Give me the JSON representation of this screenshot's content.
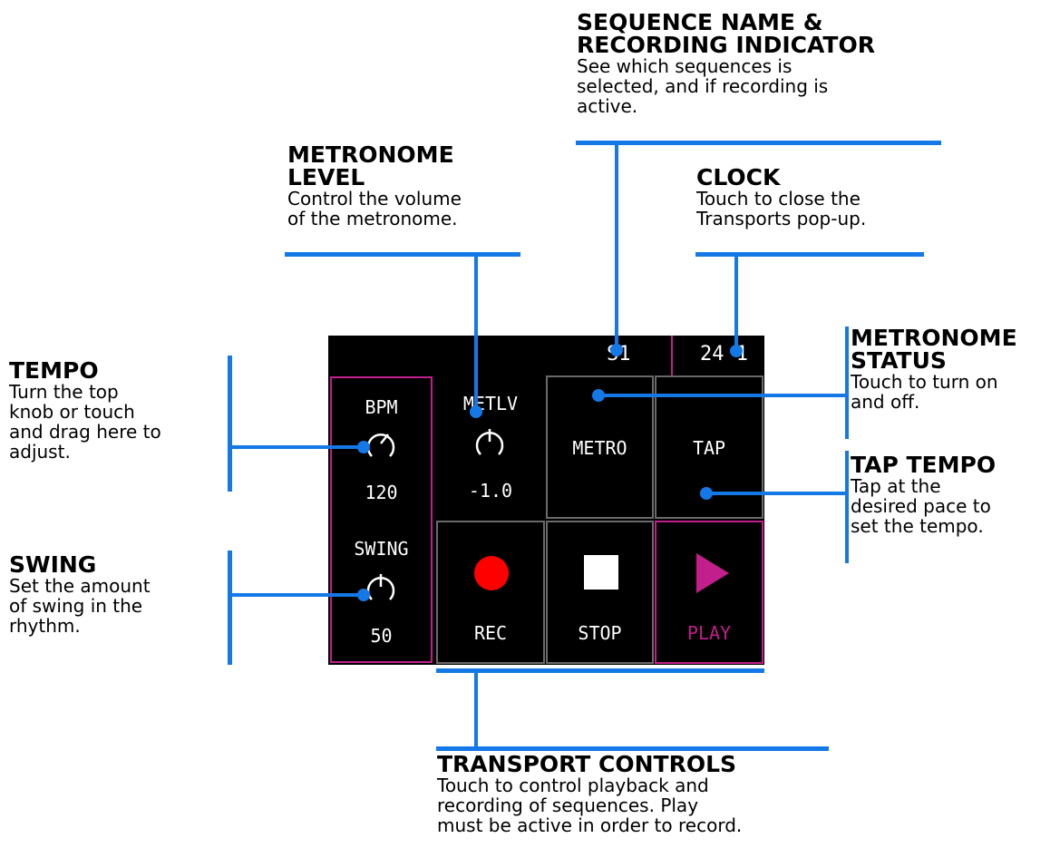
{
  "screen": {
    "sequence_name": "S1",
    "clock": "24 1",
    "bpm": {
      "label": "BPM",
      "value": "120"
    },
    "swing": {
      "label": "SWING",
      "value": "50"
    },
    "metronome_level": {
      "label": "METLV",
      "value": "-1.0"
    },
    "metro_button": "METRO",
    "tap_button": "TAP",
    "rec_button": "REC",
    "stop_button": "STOP",
    "play_button": "PLAY"
  },
  "callouts": {
    "sequence": {
      "title_line1": "SEQUENCE NAME &",
      "title_line2": "RECORDING INDICATOR",
      "desc_line1": "See which sequences is",
      "desc_line2": "selected, and if recording is",
      "desc_line3": "active."
    },
    "metronome_level": {
      "title_line1": "METRONOME",
      "title_line2": "LEVEL",
      "desc_line1": "Control the volume",
      "desc_line2": "of the metronome."
    },
    "clock": {
      "title": "CLOCK",
      "desc_line1": "Touch to close the",
      "desc_line2": "Transports pop-up."
    },
    "metronome_status": {
      "title_line1": "METRONOME",
      "title_line2": "STATUS",
      "desc_line1": "Touch to turn on",
      "desc_line2": "and off."
    },
    "tempo": {
      "title": "TEMPO",
      "desc_line1": "Turn the top",
      "desc_line2": "knob or touch",
      "desc_line3": "and drag here to",
      "desc_line4": "adjust."
    },
    "tap_tempo": {
      "title": "TAP TEMPO",
      "desc_line1": "Tap at the",
      "desc_line2": "desired pace to",
      "desc_line3": "set the tempo."
    },
    "swing": {
      "title": "SWING",
      "desc_line1": "Set the amount",
      "desc_line2": "of swing in the",
      "desc_line3": "rhythm."
    },
    "transport": {
      "title": "TRANSPORT CONTROLS",
      "desc_line1": "Touch to control playback and",
      "desc_line2": "recording of sequences. Play",
      "desc_line3": "must be active in order to record."
    }
  },
  "colors": {
    "accent": "#1479e6",
    "magenta": "#c21e8c",
    "record": "#ff0000"
  }
}
